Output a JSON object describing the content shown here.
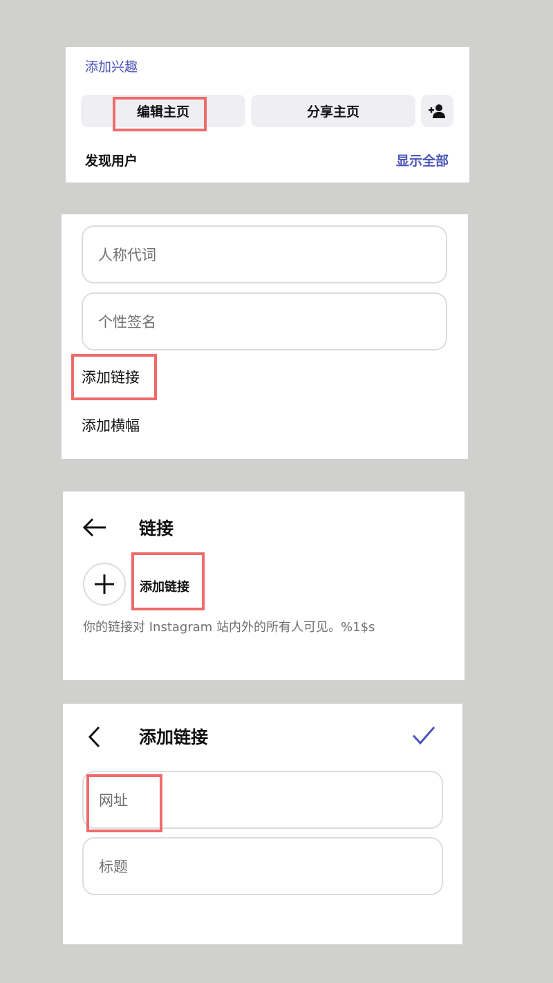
{
  "profile_panel": {
    "add_interests": "添加兴趣",
    "edit_profile": "编辑主页",
    "share_profile": "分享主页",
    "add_user_icon": "person-add-icon",
    "discover_people": "发现用户",
    "show_all": "显示全部"
  },
  "edit_panel": {
    "pronouns_placeholder": "人称代词",
    "bio_placeholder": "个性签名",
    "add_link": "添加链接",
    "add_banner": "添加横幅"
  },
  "links_panel": {
    "back_icon": "arrow-left-icon",
    "title": "链接",
    "plus_icon": "plus-icon",
    "add_link": "添加链接",
    "description": "你的链接对 Instagram 站内外的所有人可见。%1$s"
  },
  "add_link_panel": {
    "back_icon": "chevron-left-icon",
    "title": "添加链接",
    "confirm_icon": "check-icon",
    "url_placeholder": "网址",
    "title_placeholder": "标题"
  },
  "colors": {
    "accent": "#4a55b8",
    "highlight": "#ef6b6b",
    "background": "#d0d0ce"
  }
}
